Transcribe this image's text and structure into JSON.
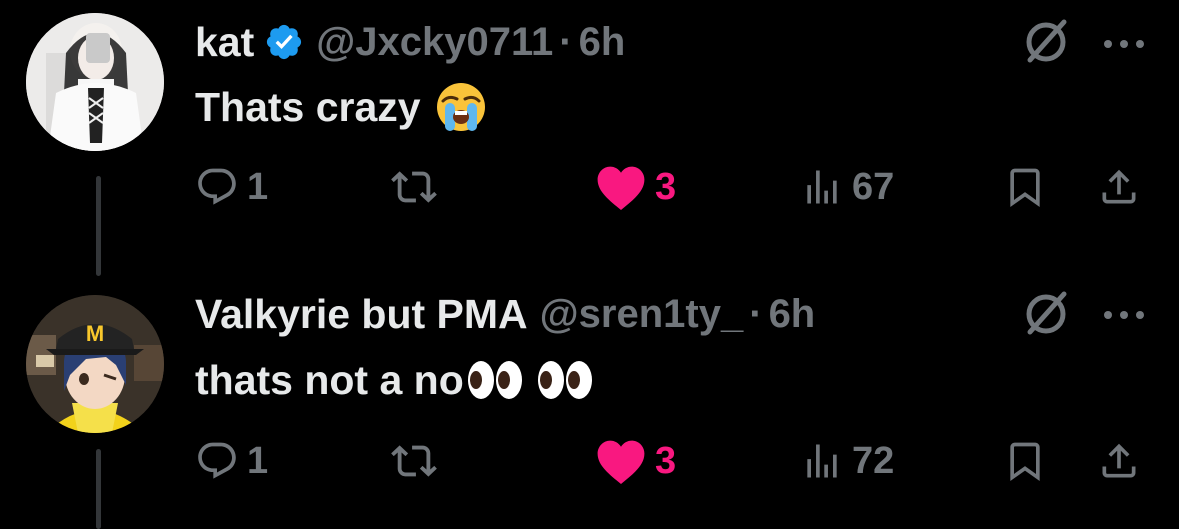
{
  "tweets": [
    {
      "name": "kat",
      "verified": true,
      "handle": "@Jxcky0711",
      "separator": "·",
      "time": "6h",
      "text": "Thats crazy",
      "emoji": "loudly-crying-face",
      "replies": "1",
      "likes": "3",
      "views": "67",
      "liked": true
    },
    {
      "name": "Valkyrie but PMA",
      "verified": false,
      "handle": "@sren1ty_",
      "separator": "·",
      "time": "6h",
      "text": "thats not a no",
      "emoji": "eyes",
      "replies": "1",
      "likes": "3",
      "views": "72",
      "liked": true
    }
  ],
  "colors": {
    "background": "#000000",
    "primary_text": "#e7e9ea",
    "secondary_text": "#71767b",
    "like_pink": "#f91880",
    "verified_blue": "#1d9bf0"
  },
  "icons": [
    "grok-icon",
    "more-icon",
    "reply-icon",
    "retweet-icon",
    "like-icon",
    "views-icon",
    "bookmark-icon",
    "share-icon"
  ]
}
